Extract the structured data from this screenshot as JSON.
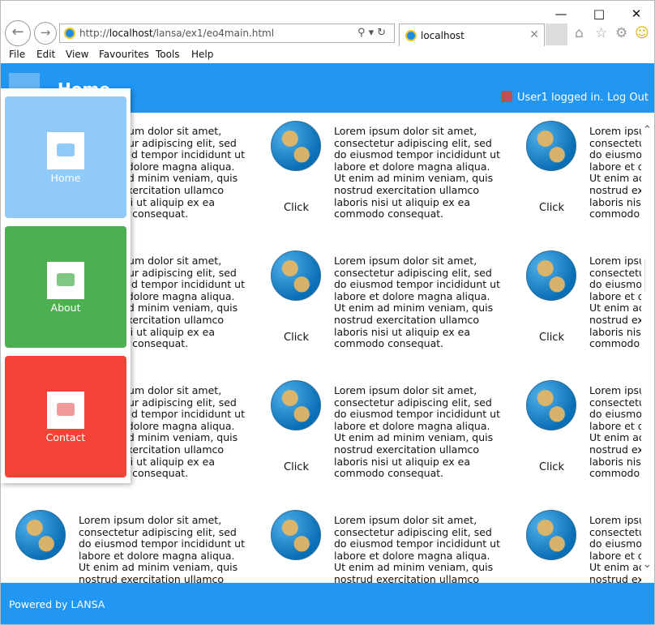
{
  "browser": {
    "url_prefix": "http://",
    "url_host": "localhost",
    "url_path": "/lansa/ex1/eo4main.html",
    "tab_title": "localhost",
    "menu": [
      "File",
      "Edit",
      "View",
      "Favourites",
      "Tools",
      "Help"
    ]
  },
  "header": {
    "title": "Home",
    "user_status": "User1 logged in.",
    "logout_label": "Log Out"
  },
  "side_menu": [
    {
      "label": "Home",
      "color": "#90caf9"
    },
    {
      "label": "About",
      "color": "#4caf50"
    },
    {
      "label": "Contact",
      "color": "#f44336"
    }
  ],
  "content": {
    "click_label": "Click",
    "lorem_lines": [
      "Lorem ipsum dolor sit amet,",
      "consectetur adipiscing elit, sed",
      "do eiusmod tempor incididunt ut",
      "labore et dolore magna aliqua.",
      "Ut enim ad minim veniam, quis",
      "nostrud exercitation ullamco",
      "laboris nisi ut aliquip ex ea",
      "commodo consequat."
    ]
  },
  "footer": {
    "text": "Powered by LANSA"
  },
  "colors": {
    "header_bg": "#2196f3",
    "footer_bg": "#2196f3"
  }
}
